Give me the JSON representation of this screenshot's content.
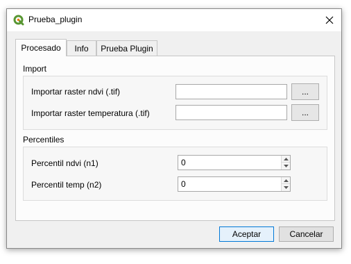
{
  "window": {
    "title": "Prueba_plugin",
    "icon": "qgis-logo-icon",
    "close_icon": "close-icon"
  },
  "tabs": [
    {
      "label": "Procesado",
      "active": true
    },
    {
      "label": "Info",
      "active": false
    },
    {
      "label": "Prueba Plugin",
      "active": false
    }
  ],
  "import_group": {
    "title": "Import",
    "rows": [
      {
        "label": "Importar raster ndvi (.tif)",
        "value": "",
        "button": "..."
      },
      {
        "label": "Importar raster temperatura (.tif)",
        "value": "",
        "button": "..."
      }
    ]
  },
  "percentiles_group": {
    "title": "Percentiles",
    "rows": [
      {
        "label": "Percentil ndvi (n1)",
        "value": "0"
      },
      {
        "label": "Percentil temp (n2)",
        "value": "0"
      }
    ]
  },
  "buttons": {
    "accept": "Aceptar",
    "cancel": "Cancelar"
  },
  "colors": {
    "accent": "#0078d7",
    "qgis_green": "#589632",
    "qgis_yellow": "#ee7913"
  }
}
